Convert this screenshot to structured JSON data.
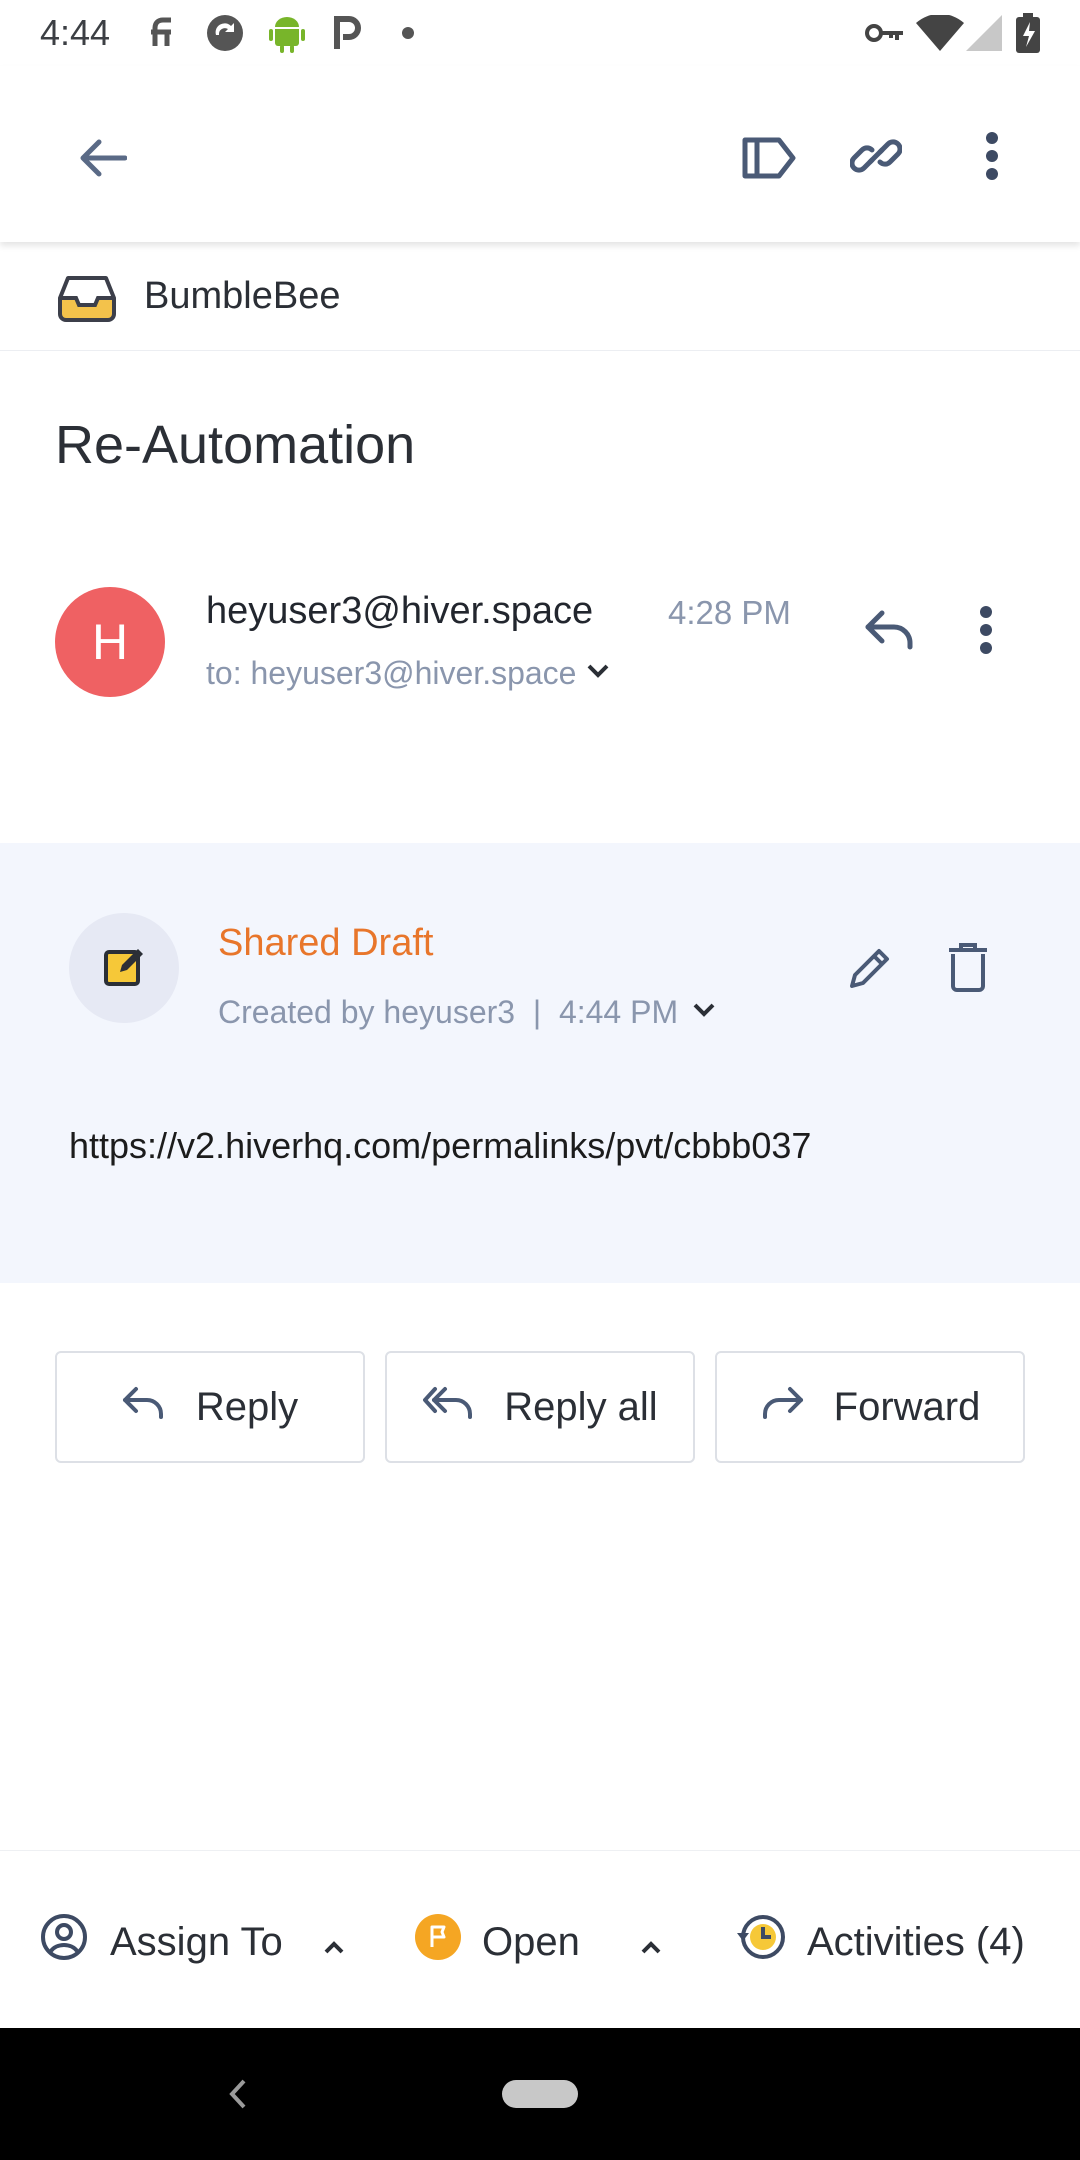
{
  "status_bar": {
    "time": "4:44"
  },
  "inbox": {
    "name": "BumbleBee",
    "icon": "inbox-tray-icon"
  },
  "email": {
    "subject": "Re-Automation",
    "avatar_letter": "H",
    "sender": "heyuser3@hiver.space",
    "time": "4:28 PM",
    "to_line": "to: heyuser3@hiver.space"
  },
  "shared_draft": {
    "title": "Shared Draft",
    "meta": "Created by heyuser3  |  4:44 PM",
    "body_link": "https://v2.hiverhq.com/permalinks/pvt/cbbb037"
  },
  "actions": {
    "reply": "Reply",
    "reply_all": "Reply all",
    "forward": "Forward"
  },
  "bottom_bar": {
    "assign": "Assign To",
    "status": "Open",
    "activities": "Activities (4)"
  },
  "colors": {
    "accent": "#e8762b",
    "avatar": "#ef6163",
    "draft_bg": "#f3f6fd",
    "status_badge": "#f5a623"
  }
}
